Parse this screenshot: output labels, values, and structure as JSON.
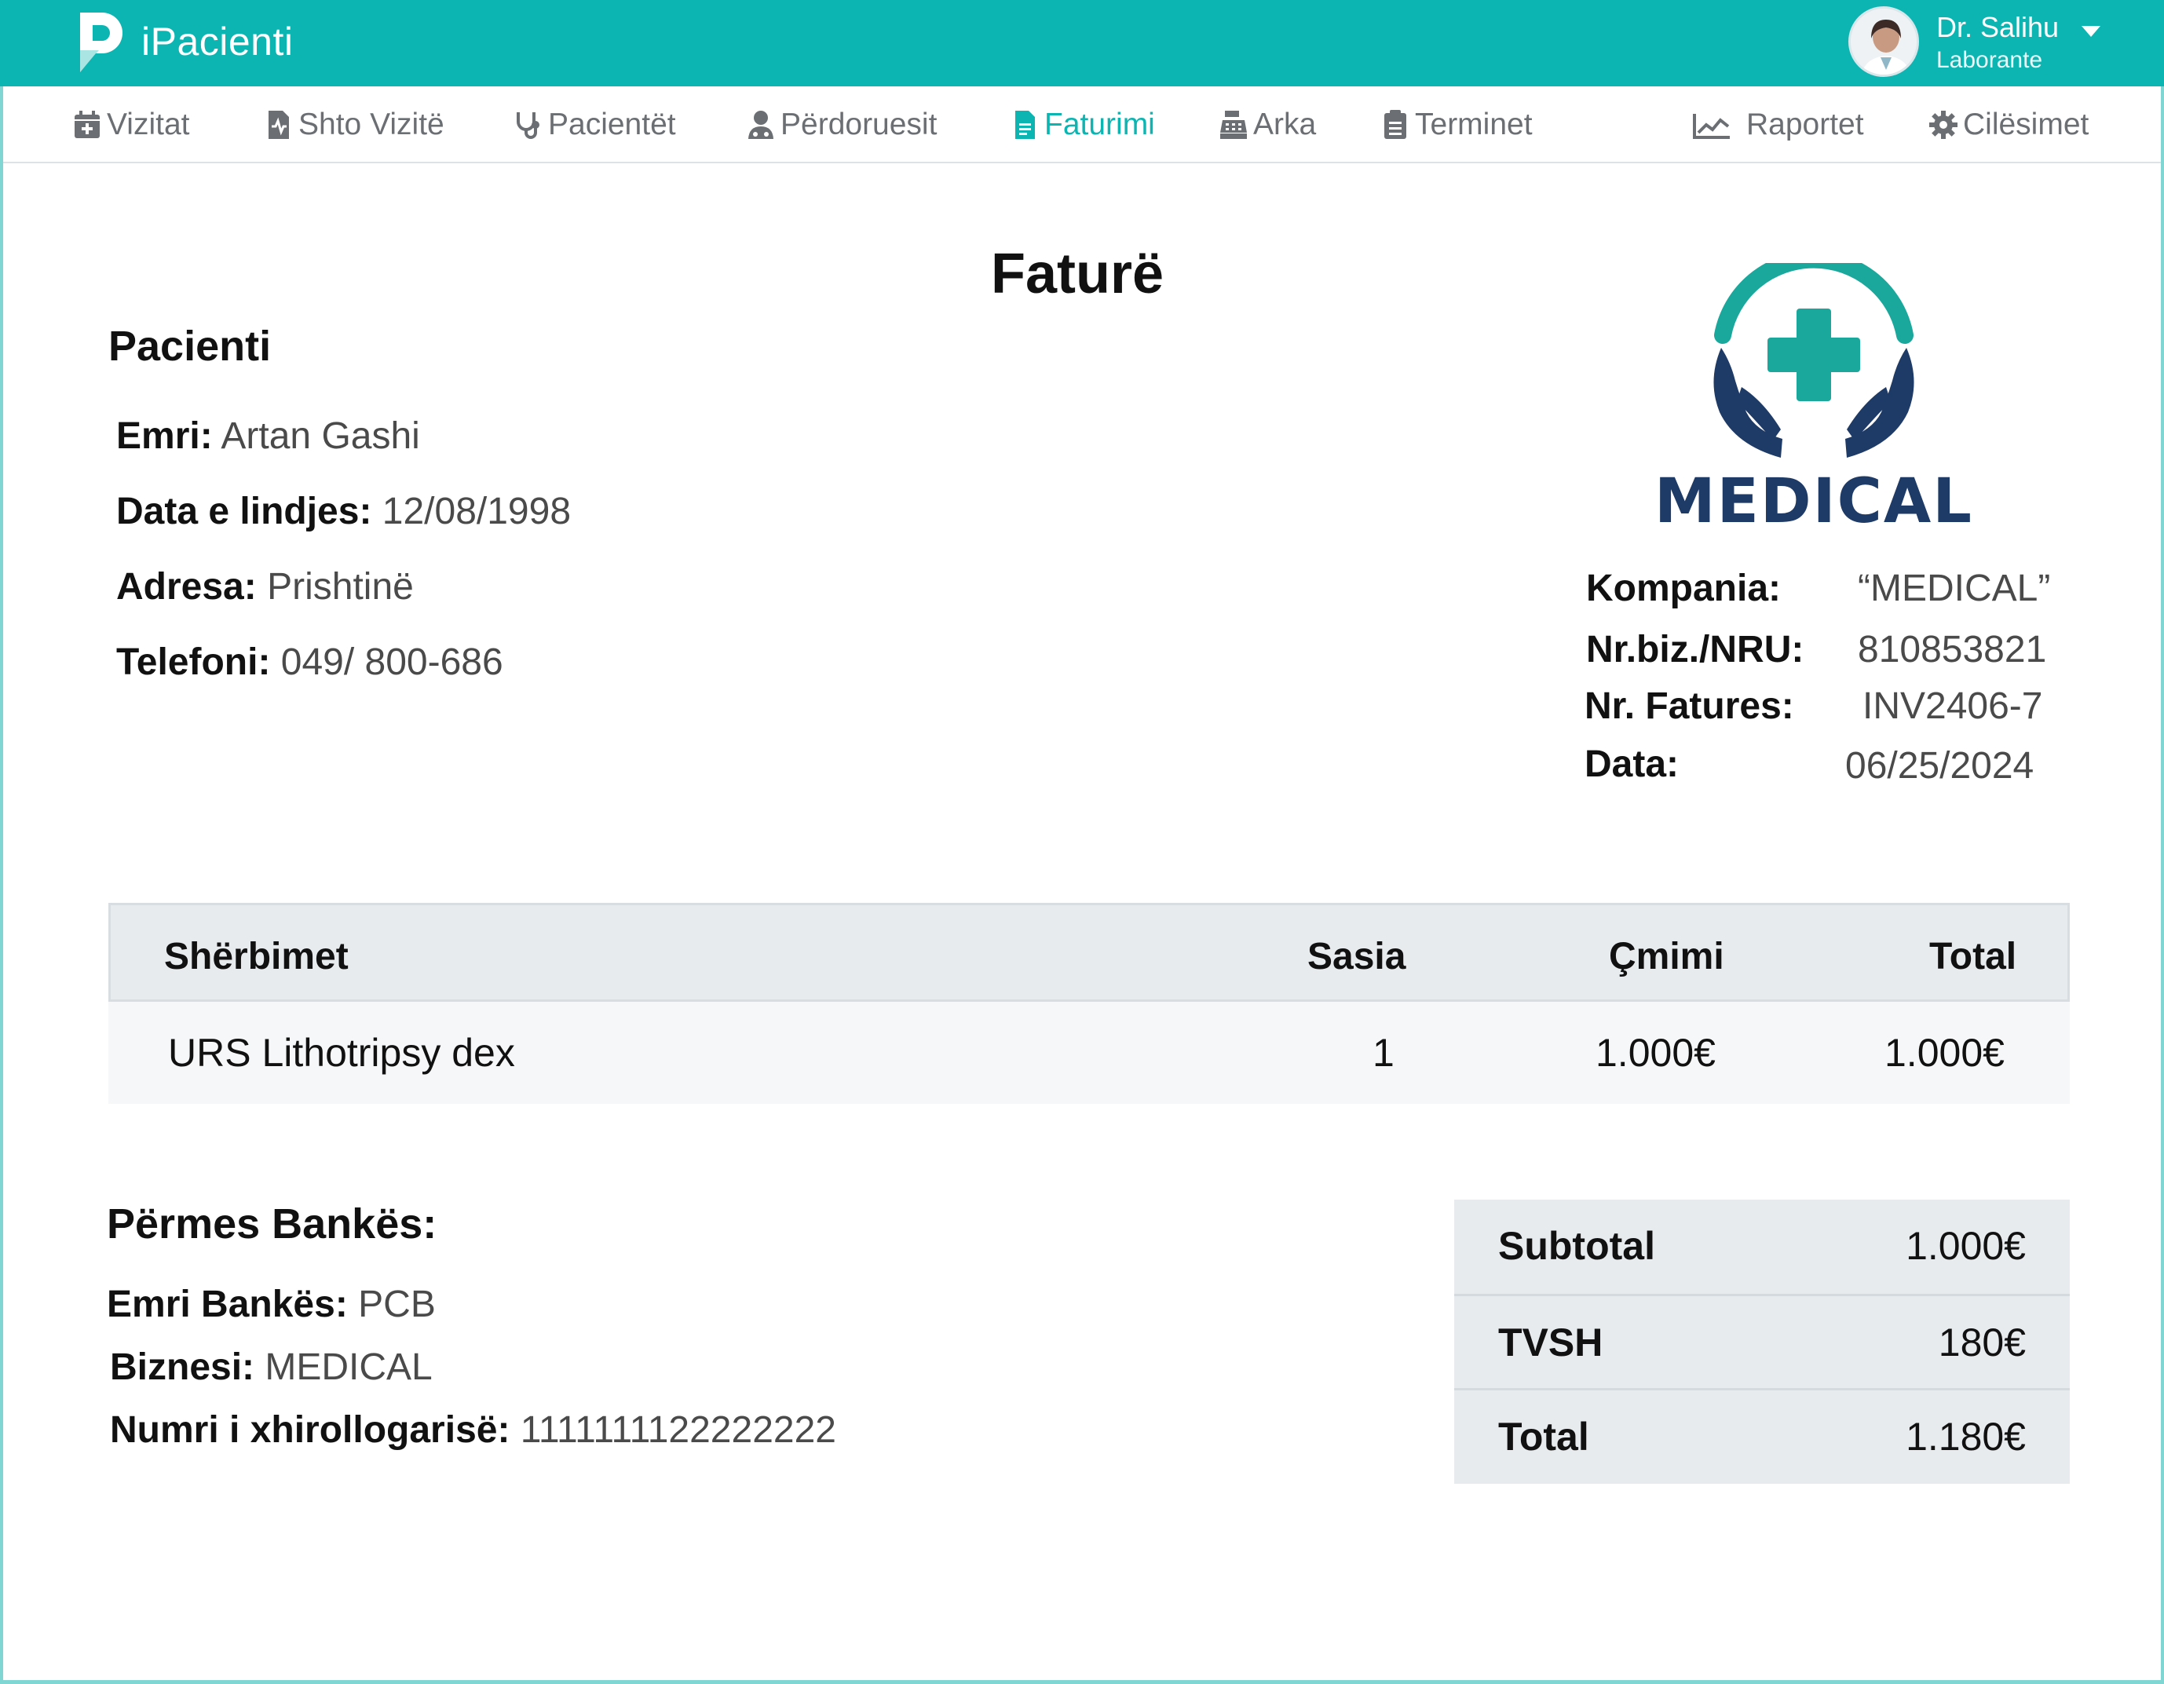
{
  "app": {
    "brand": "iPacienti"
  },
  "user": {
    "name": "Dr. Salihu",
    "role": "Laborante"
  },
  "nav": {
    "vizitat": "Vizitat",
    "shto_vizite": "Shto Vizitë",
    "pacientet": "Pacientët",
    "perdoruesit": "Përdoruesit",
    "faturimi": "Faturimi",
    "arka": "Arka",
    "terminet": "Terminet",
    "raportet": "Raportet",
    "cilesimet": "Cilësimet"
  },
  "invoice": {
    "title": "Faturë",
    "patient": {
      "heading": "Pacienti",
      "name_label": "Emri:",
      "name": "Artan Gashi",
      "dob_label": "Data e lindjes:",
      "dob": "12/08/1998",
      "address_label": "Adresa:",
      "address": "Prishtinë",
      "phone_label": "Telefoni:",
      "phone": "049/ 800-686"
    },
    "logo_text": "MEDICAL",
    "company": {
      "company_label": "Kompania:",
      "company": "“MEDICAL”",
      "nrb_label": "Nr.biz./NRU:",
      "nrb": "810853821",
      "invoice_no_label": "Nr. Fatures:",
      "invoice_no": "INV2406-7",
      "date_label": "Data:",
      "date": "06/25/2024"
    },
    "table": {
      "headers": {
        "service": "Shërbimet",
        "qty": "Sasia",
        "price": "Çmimi",
        "total": "Total"
      },
      "rows": [
        {
          "service": "URS Lithotripsy dex",
          "qty": "1",
          "price": "1.000€",
          "total": "1.000€"
        }
      ]
    },
    "bank": {
      "heading": "Përmes Bankës:",
      "bank_label": "Emri Bankës:",
      "bank": "PCB",
      "business_label": "Biznesi:",
      "business": "MEDICAL",
      "account_label": "Numri i xhirollogarisë:",
      "account": "1111111122222222"
    },
    "totals": {
      "subtotal_label": "Subtotal",
      "subtotal": "1.000€",
      "vat_label": "TVSH",
      "vat": "180€",
      "total_label": "Total",
      "total": "1.180€"
    }
  },
  "colors": {
    "accent": "#0cb5b2",
    "navy": "#1e3a66",
    "teal": "#1aa89c"
  }
}
